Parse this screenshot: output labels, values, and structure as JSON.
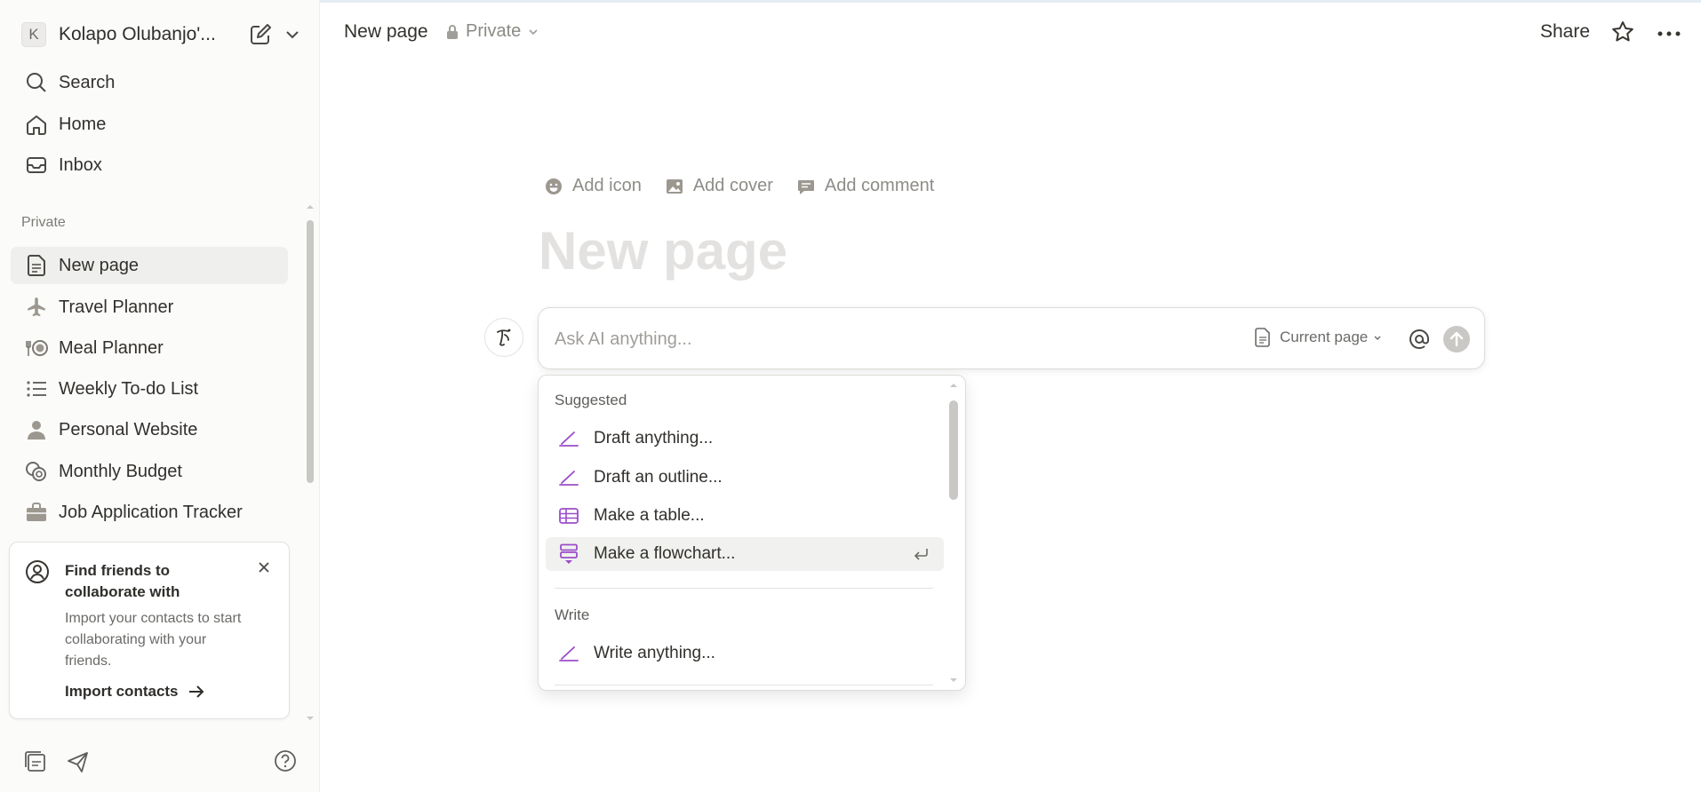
{
  "workspace": {
    "avatar_letter": "K",
    "name": "Kolapo Olubanjo'..."
  },
  "nav": [
    {
      "label": "Search",
      "icon": "search-icon"
    },
    {
      "label": "Home",
      "icon": "home-icon"
    },
    {
      "label": "Inbox",
      "icon": "inbox-icon"
    }
  ],
  "private_section": {
    "label": "Private",
    "pages": [
      {
        "label": "New page",
        "icon": "page-icon",
        "active": true
      },
      {
        "label": "Travel Planner",
        "icon": "airplane-icon"
      },
      {
        "label": "Meal Planner",
        "icon": "plate-icon"
      },
      {
        "label": "Weekly To-do List",
        "icon": "list-icon"
      },
      {
        "label": "Personal Website",
        "icon": "person-icon"
      },
      {
        "label": "Monthly Budget",
        "icon": "coins-icon"
      },
      {
        "label": "Job Application Tracker",
        "icon": "briefcase-icon"
      }
    ]
  },
  "invite_card": {
    "title": "Find friends to collaborate with",
    "body": "Import your contacts to start collaborating with your friends.",
    "link": "Import contacts"
  },
  "topbar": {
    "breadcrumb": "New page",
    "privacy": "Private",
    "share": "Share"
  },
  "page": {
    "actions": {
      "add_icon": "Add icon",
      "add_cover": "Add cover",
      "add_comment": "Add comment"
    },
    "title_placeholder": "New page"
  },
  "ai": {
    "placeholder": "Ask AI anything...",
    "context": "Current page"
  },
  "menu": {
    "suggested_label": "Suggested",
    "suggested": [
      {
        "label": "Draft anything...",
        "icon": "pen-icon"
      },
      {
        "label": "Draft an outline...",
        "icon": "pen-icon"
      },
      {
        "label": "Make a table...",
        "icon": "table-icon"
      },
      {
        "label": "Make a flowchart...",
        "icon": "flowchart-icon",
        "highlighted": true
      }
    ],
    "write_label": "Write",
    "write": [
      {
        "label": "Write anything...",
        "icon": "pen-icon"
      }
    ]
  },
  "colors": {
    "accent_purple": "#9b4dca",
    "sidebar_bg": "#fbfbfa",
    "active_bg": "#efefed"
  }
}
